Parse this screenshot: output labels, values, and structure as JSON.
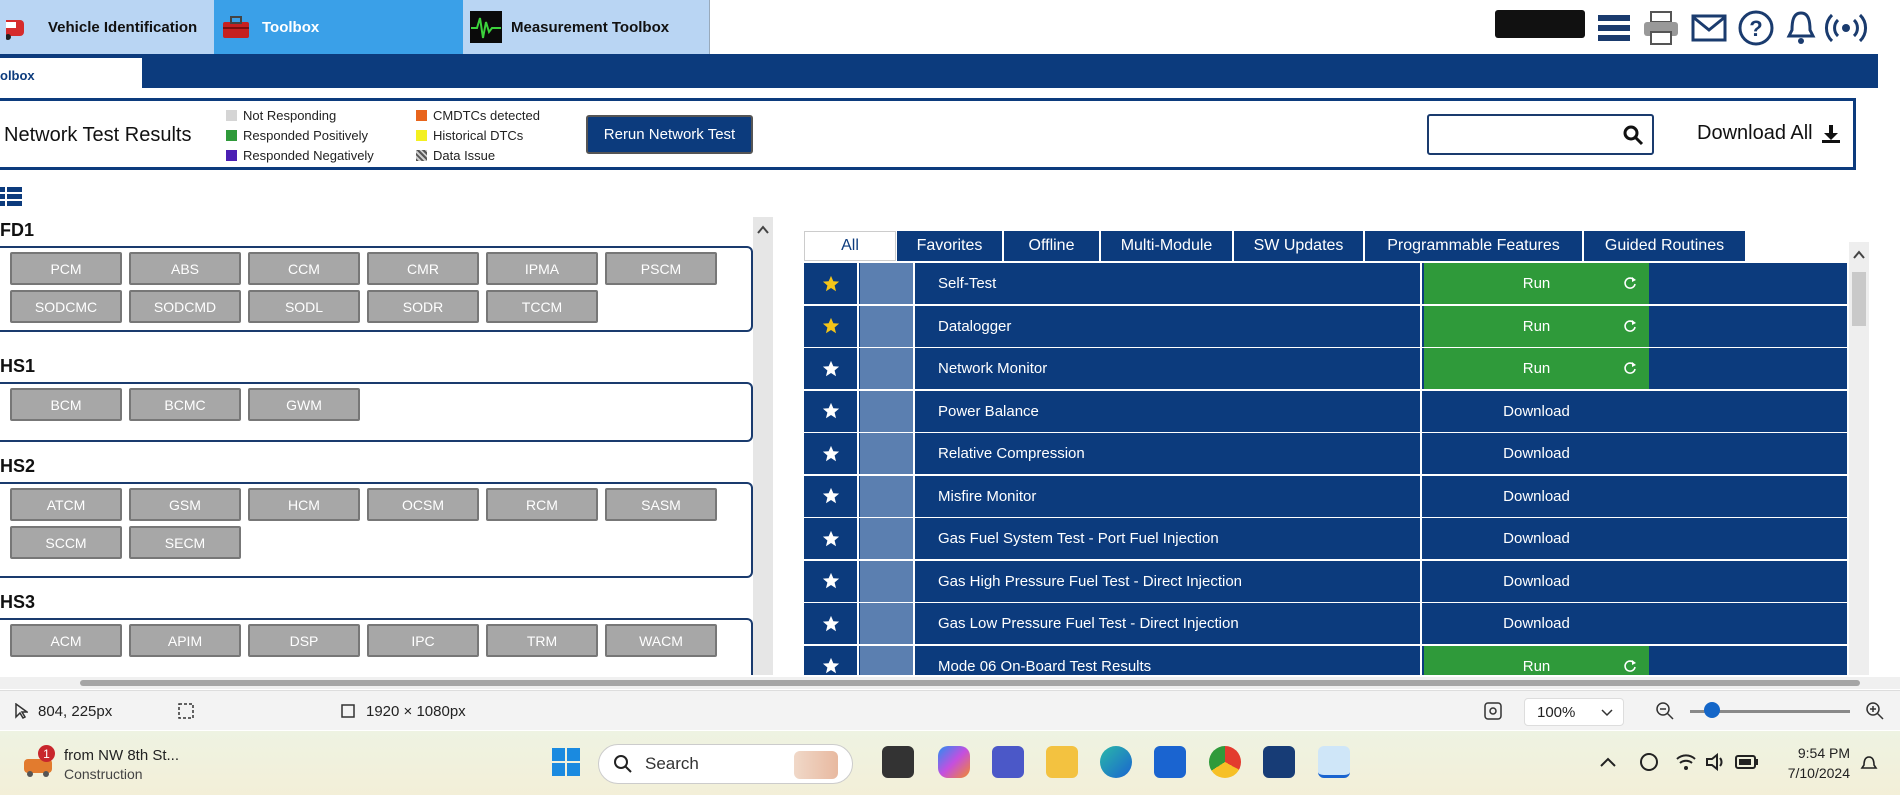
{
  "top_tabs": {
    "vehicle": "Vehicle Identification",
    "toolbox": "Toolbox",
    "measurement": "Measurement Toolbox"
  },
  "sub_tab": "olbox",
  "network": {
    "title": "Network Test Results",
    "legend": {
      "not_responding": "Not Responding",
      "responded_positively": "Responded Positively",
      "responded_negatively": "Responded Negatively",
      "cmdtcs": "CMDTCs detected",
      "historical": "Historical DTCs",
      "data_issue": "Data Issue"
    },
    "rerun": "Rerun Network Test",
    "search_placeholder": "",
    "download_all": "Download All"
  },
  "modules": {
    "groups": [
      {
        "label": "FD1",
        "items": [
          "PCM",
          "ABS",
          "CCM",
          "CMR",
          "IPMA",
          "PSCM",
          "SODCMC",
          "SODCMD",
          "SODL",
          "SODR",
          "TCCM"
        ]
      },
      {
        "label": "HS1",
        "items": [
          "BCM",
          "BCMC",
          "GWM"
        ]
      },
      {
        "label": "HS2",
        "items": [
          "ATCM",
          "GSM",
          "HCM",
          "OCSM",
          "RCM",
          "SASM",
          "SCCM",
          "SECM"
        ]
      },
      {
        "label": "HS3",
        "items": [
          "ACM",
          "APIM",
          "DSP",
          "IPC",
          "TRM",
          "WACM"
        ]
      }
    ]
  },
  "test_tabs": [
    "All",
    "Favorites",
    "Offline",
    "Multi-Module",
    "SW Updates",
    "Programmable Features",
    "Guided Routines"
  ],
  "tests": [
    {
      "name": "Self-Test",
      "action": "Run",
      "favorite": true
    },
    {
      "name": "Datalogger",
      "action": "Run",
      "favorite": true
    },
    {
      "name": "Network Monitor",
      "action": "Run",
      "favorite": false
    },
    {
      "name": "Power Balance",
      "action": "Download",
      "favorite": false
    },
    {
      "name": "Relative Compression",
      "action": "Download",
      "favorite": false
    },
    {
      "name": "Misfire Monitor",
      "action": "Download",
      "favorite": false
    },
    {
      "name": "Gas Fuel System Test - Port Fuel Injection",
      "action": "Download",
      "favorite": false
    },
    {
      "name": "Gas High Pressure Fuel Test - Direct Injection",
      "action": "Download",
      "favorite": false
    },
    {
      "name": "Gas Low Pressure Fuel Test - Direct Injection",
      "action": "Download",
      "favorite": false
    },
    {
      "name": "Mode 06 On-Board Test Results",
      "action": "Run",
      "favorite": false
    }
  ],
  "status": {
    "cursor": "804, 225px",
    "dimensions": "1920 × 1080px",
    "zoom": "100%"
  },
  "taskbar": {
    "notification_count": "1",
    "notification_title": "from NW 8th St...",
    "notification_sub": "Construction",
    "search": "Search",
    "time": "9:54 PM",
    "date": "7/10/2024"
  },
  "colors": {
    "navy": "#0c3b7d",
    "run_green": "#2f9a3a",
    "module_gray": "#a7a7a7",
    "not_responding": "#d5d5d5",
    "responded_positively": "#2f9a3a",
    "responded_negatively": "#4b1fb3",
    "cmdtcs": "#e8641c",
    "historical": "#f3f020"
  }
}
